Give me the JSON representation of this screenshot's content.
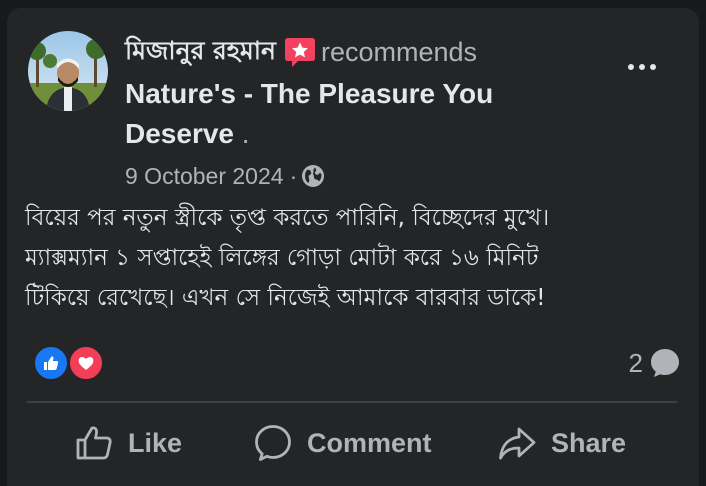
{
  "post": {
    "author": "মিজানুর রহমান",
    "recommends": "recommends",
    "page_name": "Nature's - The Pleasure You Deserve",
    "page_suffix": " .",
    "date": "9 October 2024",
    "separator": "·",
    "audience_icon": "globe-icon",
    "body_lines": [
      "বিয়ের পর নতুন স্ত্রীকে তৃপ্ত করতে পারিনি, বিচ্ছেদের মুখে।",
      "ম্যাক্সম্যান ১ সপ্তাহেই লিঙ্গের গোড়া মোটা করে ১৬ মিনিট",
      "টিকিয়ে রেখেছে। এখন সে নিজেই আমাকে বারবার ডাকে!"
    ]
  },
  "reactions": {
    "types": [
      "like-icon",
      "love-icon"
    ],
    "comment_count": "2"
  },
  "actions": {
    "like": "Like",
    "comment": "Comment",
    "share": "Share"
  },
  "colors": {
    "background": "#18191a",
    "card": "#242526",
    "primary_text": "#e4e6eb",
    "secondary_text": "#b0b3b8",
    "like_blue": "#1877f2",
    "love_red": "#f33e58",
    "recommend_pink": "#f3425f"
  }
}
